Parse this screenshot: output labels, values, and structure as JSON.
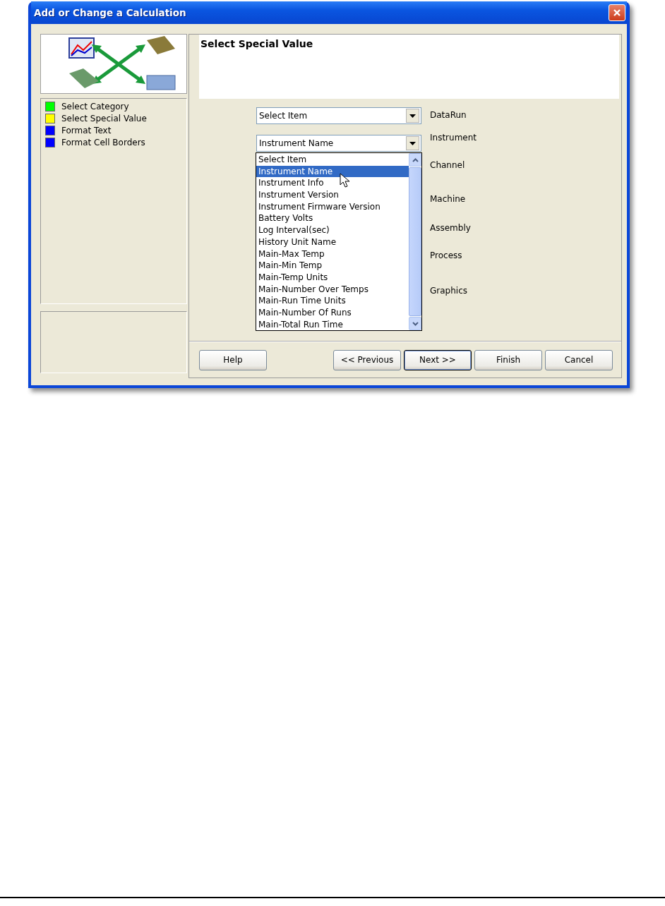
{
  "window": {
    "title": "Add or Change a Calculation"
  },
  "steps": [
    {
      "label": "Select Category",
      "color": "#00ff00"
    },
    {
      "label": "Select Special Value",
      "color": "#ffff00"
    },
    {
      "label": "Format Text",
      "color": "#0000ff"
    },
    {
      "label": "Format Cell Borders",
      "color": "#0000ff"
    }
  ],
  "header": {
    "title": "Select Special Value"
  },
  "selectors": [
    {
      "label": "DataRun",
      "value": "Select Item"
    },
    {
      "label": "Instrument",
      "value": "Instrument Name"
    }
  ],
  "dropdown_list": {
    "items": [
      {
        "label": "Select Item",
        "selected": false
      },
      {
        "label": "Instrument Name",
        "selected": true
      },
      {
        "label": "Instrument Info",
        "selected": false
      },
      {
        "label": "Instrument Version",
        "selected": false
      },
      {
        "label": "Instrument Firmware Version",
        "selected": false
      },
      {
        "label": "Battery Volts",
        "selected": false
      },
      {
        "label": "Log Interval(sec)",
        "selected": false
      },
      {
        "label": "History Unit Name",
        "selected": false
      },
      {
        "label": "Main-Max Temp",
        "selected": false
      },
      {
        "label": "Main-Min Temp",
        "selected": false
      },
      {
        "label": "Main-Temp Units",
        "selected": false
      },
      {
        "label": "Main-Number Over Temps",
        "selected": false
      },
      {
        "label": "Main-Run Time Units",
        "selected": false
      },
      {
        "label": "Main-Number Of Runs",
        "selected": false
      },
      {
        "label": "Main-Total Run Time",
        "selected": false
      }
    ]
  },
  "hidden_field_labels": [
    "Channel",
    "Machine",
    "Assembly",
    "Process",
    "Graphics"
  ],
  "buttons": [
    {
      "label": "Help",
      "default": false
    },
    {
      "label": "<< Previous",
      "default": false
    },
    {
      "label": "Next >>",
      "default": true
    },
    {
      "label": "Finish",
      "default": false
    },
    {
      "label": "Cancel",
      "default": false
    }
  ]
}
